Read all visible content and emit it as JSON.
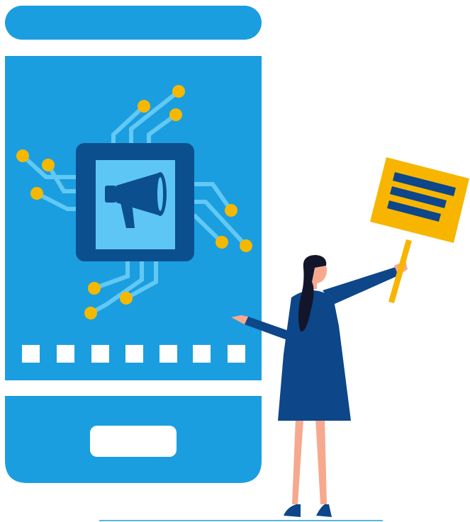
{
  "palette": {
    "phone_blue": "#1a9ee0",
    "chip_dark": "#0b4f8f",
    "chip_light": "#5ec6f5",
    "trace_light": "#62c8f4",
    "node_yellow": "#f5b800",
    "white": "#ffffff",
    "dress_navy": "#0d4689",
    "hair_black": "#13152b",
    "skin": "#f6a98e",
    "sign_yellow": "#f7b500",
    "sign_stripe": "#0d4689"
  },
  "icons": {
    "chip": "microchip-icon",
    "megaphone": "megaphone-icon",
    "sign": "protest-sign-icon",
    "person": "woman-figure"
  },
  "screen_dots_count": 7
}
